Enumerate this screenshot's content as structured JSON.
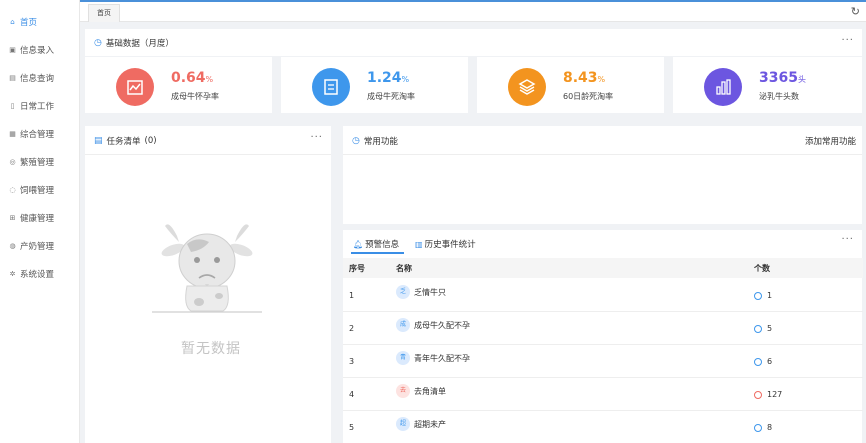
{
  "sidebar": {
    "items": [
      {
        "label": "首页",
        "icon": "home-icon",
        "active": true
      },
      {
        "label": "信息录入",
        "icon": "edit-icon"
      },
      {
        "label": "信息查询",
        "icon": "document-icon"
      },
      {
        "label": "日常工作",
        "icon": "file-icon"
      },
      {
        "label": "综合管理",
        "icon": "grid-icon"
      },
      {
        "label": "繁殖管理",
        "icon": "target-icon"
      },
      {
        "label": "饲喂管理",
        "icon": "search-icon"
      },
      {
        "label": "健康管理",
        "icon": "health-icon"
      },
      {
        "label": "产奶管理",
        "icon": "milk-icon"
      },
      {
        "label": "系统设置",
        "icon": "gear-icon"
      }
    ]
  },
  "tabs": {
    "home": "首页"
  },
  "basic": {
    "title": "基础数据（月度）",
    "stats": [
      {
        "value": "0.64",
        "unit": "%",
        "label": "成母牛怀孕率",
        "color": "#ef6b62",
        "icon": "chart-icon"
      },
      {
        "value": "1.24",
        "unit": "%",
        "label": "成母牛死淘率",
        "color": "#3e97ec",
        "icon": "document-icon"
      },
      {
        "value": "8.43",
        "unit": "%",
        "label": "60日龄死淘率",
        "color": "#f3941f",
        "icon": "layers-icon"
      },
      {
        "value": "3365",
        "unit": "头",
        "label": "泌乳牛头数",
        "color": "#6c56e0",
        "icon": "bar-chart-icon"
      }
    ]
  },
  "tasks": {
    "title": "任务清单",
    "count": "(0)",
    "empty_text": "暂无数据"
  },
  "common": {
    "title": "常用功能",
    "add_label": "添加常用功能"
  },
  "warning": {
    "tab_active": "预警信息",
    "tab_other": "历史事件统计",
    "col_index": "序号",
    "col_name": "名称",
    "col_count": "个数",
    "rows": [
      {
        "index": "1",
        "badge": "乏",
        "name": "乏情牛只",
        "count": "1",
        "badge_color": "#3e97ec",
        "count_color": "#3e97ec"
      },
      {
        "index": "2",
        "badge": "成",
        "name": "成母牛久配不孕",
        "count": "5",
        "badge_color": "#3e97ec",
        "count_color": "#3e97ec"
      },
      {
        "index": "3",
        "badge": "青",
        "name": "青年牛久配不孕",
        "count": "6",
        "badge_color": "#3e97ec",
        "count_color": "#3e97ec"
      },
      {
        "index": "4",
        "badge": "去",
        "name": "去角清单",
        "count": "127",
        "badge_color": "#ef6b62",
        "count_color": "#ef6b62"
      },
      {
        "index": "5",
        "badge": "超",
        "name": "超期未产",
        "count": "8",
        "badge_color": "#3e97ec",
        "count_color": "#3e97ec"
      }
    ]
  }
}
